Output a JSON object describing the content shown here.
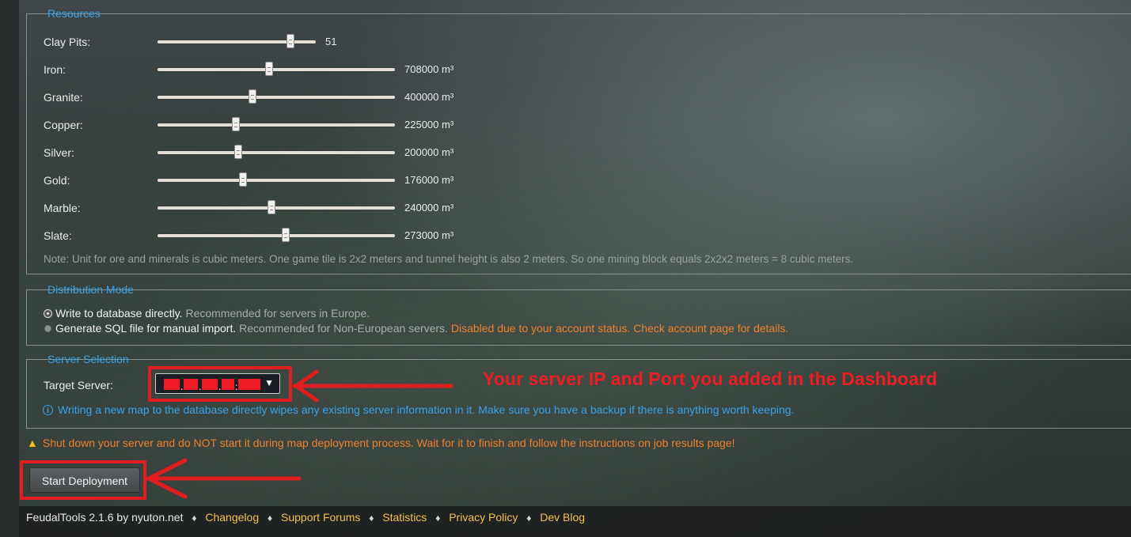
{
  "resources": {
    "legend": "Resources",
    "items": [
      {
        "label": "Clay Pits:",
        "value_text": "51",
        "level": 0.84
      },
      {
        "label": "Iron:",
        "value_text": "708000 m³",
        "level": 0.47
      },
      {
        "label": "Granite:",
        "value_text": "400000 m³",
        "level": 0.4
      },
      {
        "label": "Copper:",
        "value_text": "225000 m³",
        "level": 0.33
      },
      {
        "label": "Silver:",
        "value_text": "200000 m³",
        "level": 0.34
      },
      {
        "label": "Gold:",
        "value_text": "176000 m³",
        "level": 0.36
      },
      {
        "label": "Marble:",
        "value_text": "240000 m³",
        "level": 0.48
      },
      {
        "label": "Slate:",
        "value_text": "273000 m³",
        "level": 0.54
      }
    ],
    "note": "Note: Unit for ore and minerals is cubic meters. One game tile is 2x2 meters and tunnel height is also 2 meters. So one mining block equals 2x2x2 meters = 8 cubic meters."
  },
  "distribution": {
    "legend": "Distribution Mode",
    "options": [
      {
        "label": "Write to database directly.",
        "desc": "Recommended for servers in Europe.",
        "warning": "",
        "selected": true
      },
      {
        "label": "Generate SQL file for manual import.",
        "desc": "Recommended for Non-European servers.",
        "warning": "Disabled due to your account status. Check account page for details.",
        "selected": false
      }
    ]
  },
  "server": {
    "legend": "Server Selection",
    "target_label": "Target Server:",
    "info_text": "Writing a new map to the database directly wipes any existing server information in it. Make sure you have a backup if there is anything worth keeping.",
    "select_arrow": "▼"
  },
  "annotation": "Your server IP and Port you added in the Dashboard",
  "warning": "Shut down your server and do NOT start it during map deployment process. Wait for it to finish and follow the instructions on job results page!",
  "start_button": "Start Deployment",
  "footer": {
    "brand": "FeudalTools 2.1.6 by nyuton.net",
    "separator": "♦",
    "links": [
      "Changelog",
      "Support Forums",
      "Statistics",
      "Privacy Policy",
      "Dev Blog"
    ]
  },
  "colors": {
    "accent": "#3aa2ea",
    "warning": "#f07f2c",
    "link": "#f0c24a",
    "annotation": "#ee1d23"
  }
}
